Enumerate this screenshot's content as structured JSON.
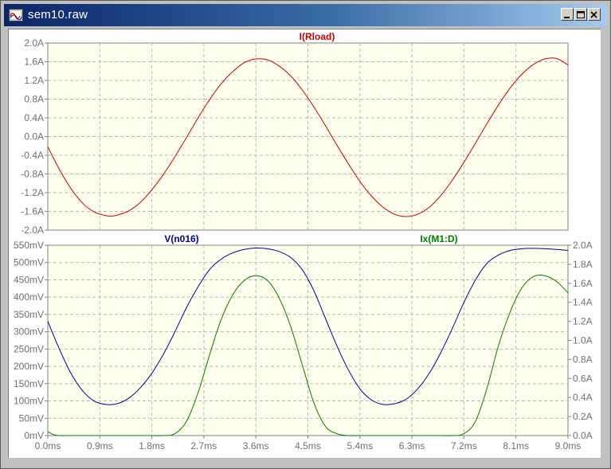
{
  "window": {
    "title": "sem10.raw"
  },
  "colors": {
    "red": "#cc0000",
    "blue": "#000099",
    "green": "#007f00",
    "grid": "#b8b8b8",
    "bg": "#ffffee"
  },
  "chart_data": [
    {
      "type": "line",
      "title": "",
      "xlabel": "",
      "ylabel": "",
      "series": [
        {
          "name": "I(Rload)",
          "color": "#cc0000",
          "x": [
            0,
            0.2,
            0.4,
            0.6,
            0.8,
            1.0,
            1.1,
            1.2,
            1.4,
            1.6,
            1.8,
            2.0,
            2.2,
            2.4,
            2.6,
            2.8,
            3.0,
            3.2,
            3.4,
            3.6,
            3.8,
            4.0,
            4.2,
            4.4,
            4.6,
            4.8,
            5.0,
            5.2,
            5.4,
            5.6,
            5.8,
            6.0,
            6.2,
            6.4,
            6.6,
            6.8,
            7.0,
            7.2,
            7.4,
            7.6,
            7.8,
            8.0,
            8.2,
            8.4,
            8.6,
            8.8,
            9.0
          ],
          "y": [
            -0.22,
            -0.7,
            -1.11,
            -1.42,
            -1.61,
            -1.69,
            -1.7,
            -1.68,
            -1.59,
            -1.41,
            -1.14,
            -0.81,
            -0.43,
            -0.02,
            0.4,
            0.79,
            1.13,
            1.39,
            1.58,
            1.66,
            1.64,
            1.51,
            1.3,
            1.0,
            0.64,
            0.24,
            -0.18,
            -0.58,
            -0.96,
            -1.27,
            -1.51,
            -1.66,
            -1.71,
            -1.66,
            -1.51,
            -1.26,
            -0.93,
            -0.55,
            -0.14,
            0.28,
            0.68,
            1.04,
            1.33,
            1.54,
            1.66,
            1.67,
            1.53
          ]
        }
      ],
      "xticks": [
        "0.0ms",
        "0.9ms",
        "1.8ms",
        "2.7ms",
        "3.6ms",
        "4.5ms",
        "5.4ms",
        "6.3ms",
        "7.2ms",
        "8.1ms",
        "9.0ms"
      ],
      "yticks": [
        "2.0A",
        "1.6A",
        "1.2A",
        "0.8A",
        "0.4A",
        "0.0A",
        "-0.4A",
        "-0.8A",
        "-1.2A",
        "-1.6A",
        "-2.0A"
      ],
      "xlim": [
        0,
        9
      ],
      "ylim": [
        -2,
        2
      ],
      "grid": true
    },
    {
      "type": "line",
      "title": "",
      "xlabel": "",
      "ylabel": "",
      "series": [
        {
          "name": "V(n016)",
          "color": "#000099",
          "axis": "left",
          "x": [
            0,
            0.2,
            0.4,
            0.6,
            0.8,
            1.0,
            1.2,
            1.4,
            1.6,
            1.8,
            2.0,
            2.2,
            2.4,
            2.6,
            2.8,
            3.0,
            3.2,
            3.4,
            3.6,
            3.8,
            4.0,
            4.2,
            4.4,
            4.6,
            4.8,
            5.0,
            5.2,
            5.4,
            5.6,
            5.8,
            6.0,
            6.2,
            6.4,
            6.6,
            6.8,
            7.0,
            7.2,
            7.4,
            7.6,
            7.8,
            8.0,
            8.2,
            8.4,
            8.6,
            8.8,
            9.0
          ],
          "y": [
            330,
            250,
            180,
            130,
            100,
            90,
            92,
            108,
            138,
            180,
            235,
            300,
            370,
            430,
            480,
            510,
            528,
            538,
            542,
            540,
            532,
            515,
            480,
            420,
            340,
            260,
            190,
            135,
            103,
            90,
            92,
            105,
            135,
            180,
            240,
            310,
            385,
            450,
            498,
            522,
            535,
            540,
            541,
            540,
            538,
            535
          ]
        },
        {
          "name": "Ix(M1:D)",
          "color": "#007f00",
          "axis": "right",
          "x": [
            0,
            0.1,
            0.2,
            0.4,
            0.6,
            0.8,
            1.0,
            1.2,
            1.4,
            1.6,
            1.8,
            2.0,
            2.2,
            2.4,
            2.6,
            2.8,
            3.0,
            3.2,
            3.4,
            3.6,
            3.8,
            4.0,
            4.2,
            4.4,
            4.6,
            4.8,
            5.0,
            5.2,
            5.4,
            5.6,
            5.8,
            6.0,
            6.2,
            6.4,
            6.6,
            6.8,
            7.0,
            7.2,
            7.4,
            7.6,
            7.8,
            8.0,
            8.2,
            8.4,
            8.6,
            8.8,
            9.0
          ],
          "y": [
            0.04,
            0.01,
            0,
            0,
            0,
            0,
            0,
            0,
            0,
            0,
            0,
            0,
            0.02,
            0.15,
            0.45,
            0.85,
            1.22,
            1.48,
            1.63,
            1.68,
            1.63,
            1.45,
            1.15,
            0.75,
            0.35,
            0.1,
            0.02,
            0,
            0,
            0,
            0,
            0,
            0,
            0,
            0,
            0,
            0,
            0.02,
            0.15,
            0.5,
            0.95,
            1.3,
            1.55,
            1.67,
            1.68,
            1.62,
            1.5
          ]
        }
      ],
      "xticks": [
        "0.0ms",
        "0.9ms",
        "1.8ms",
        "2.7ms",
        "3.6ms",
        "4.5ms",
        "5.4ms",
        "6.3ms",
        "7.2ms",
        "8.1ms",
        "9.0ms"
      ],
      "yticks_left": [
        "550mV",
        "500mV",
        "450mV",
        "400mV",
        "350mV",
        "300mV",
        "250mV",
        "200mV",
        "150mV",
        "100mV",
        "50mV",
        "0mV"
      ],
      "yticks_right": [
        "2.0A",
        "1.8A",
        "1.6A",
        "1.4A",
        "1.2A",
        "1.0A",
        "0.8A",
        "0.6A",
        "0.4A",
        "0.2A",
        "0.0A"
      ],
      "xlim": [
        0,
        9
      ],
      "ylim_left": [
        0,
        550
      ],
      "ylim_right": [
        0,
        2.0
      ],
      "grid": true
    }
  ]
}
